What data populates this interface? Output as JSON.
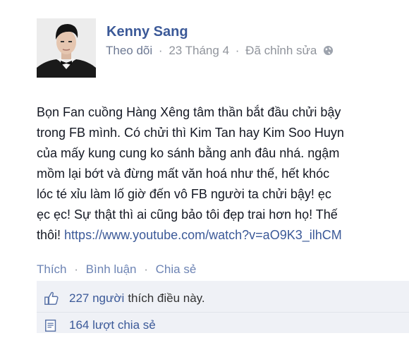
{
  "post": {
    "author": "Kenny Sang",
    "meta": {
      "follow": "Theo dõi",
      "date": "23 Tháng 4",
      "edited": "Đã chỉnh sửa",
      "separator": "·"
    },
    "body_lines": [
      "Bọn Fan cuồng Hàng Xêng tâm thần bắt đầu chửi bậy",
      "trong FB mình. Có chửi thì Kim Tan hay Kim Soo Huyn",
      "của mấy kung cung ko sánh bằng anh đâu nhá. ngậm",
      "mồm lại bớt và đừng mất văn hoá như thế, hết khóc",
      "lóc té xỉu làm lố giờ đến vô FB người ta chửi bậy! ẹc",
      "ẹc ẹc! Sự thật thì ai cũng bảo tôi đẹp trai hơn họ! Thế"
    ],
    "body_last_prefix": "thôi!",
    "body_link": "https://www.youtube.com/watch?v=aO9K3_ilhCM"
  },
  "actions": {
    "like": "Thích",
    "comment": "Bình luận",
    "share": "Chia sẻ",
    "separator": "·"
  },
  "stats": {
    "likes_link": "227 người",
    "likes_text": "thích điều này.",
    "shares_link": "164 lượt chia sẻ"
  },
  "icons": {
    "avatar": "profile-photo",
    "privacy": "globe-icon",
    "like": "thumbs-up-icon",
    "share": "share-icon"
  },
  "colors": {
    "link": "#3b5998",
    "meta": "#90949c",
    "panel": "#eff1f6"
  }
}
